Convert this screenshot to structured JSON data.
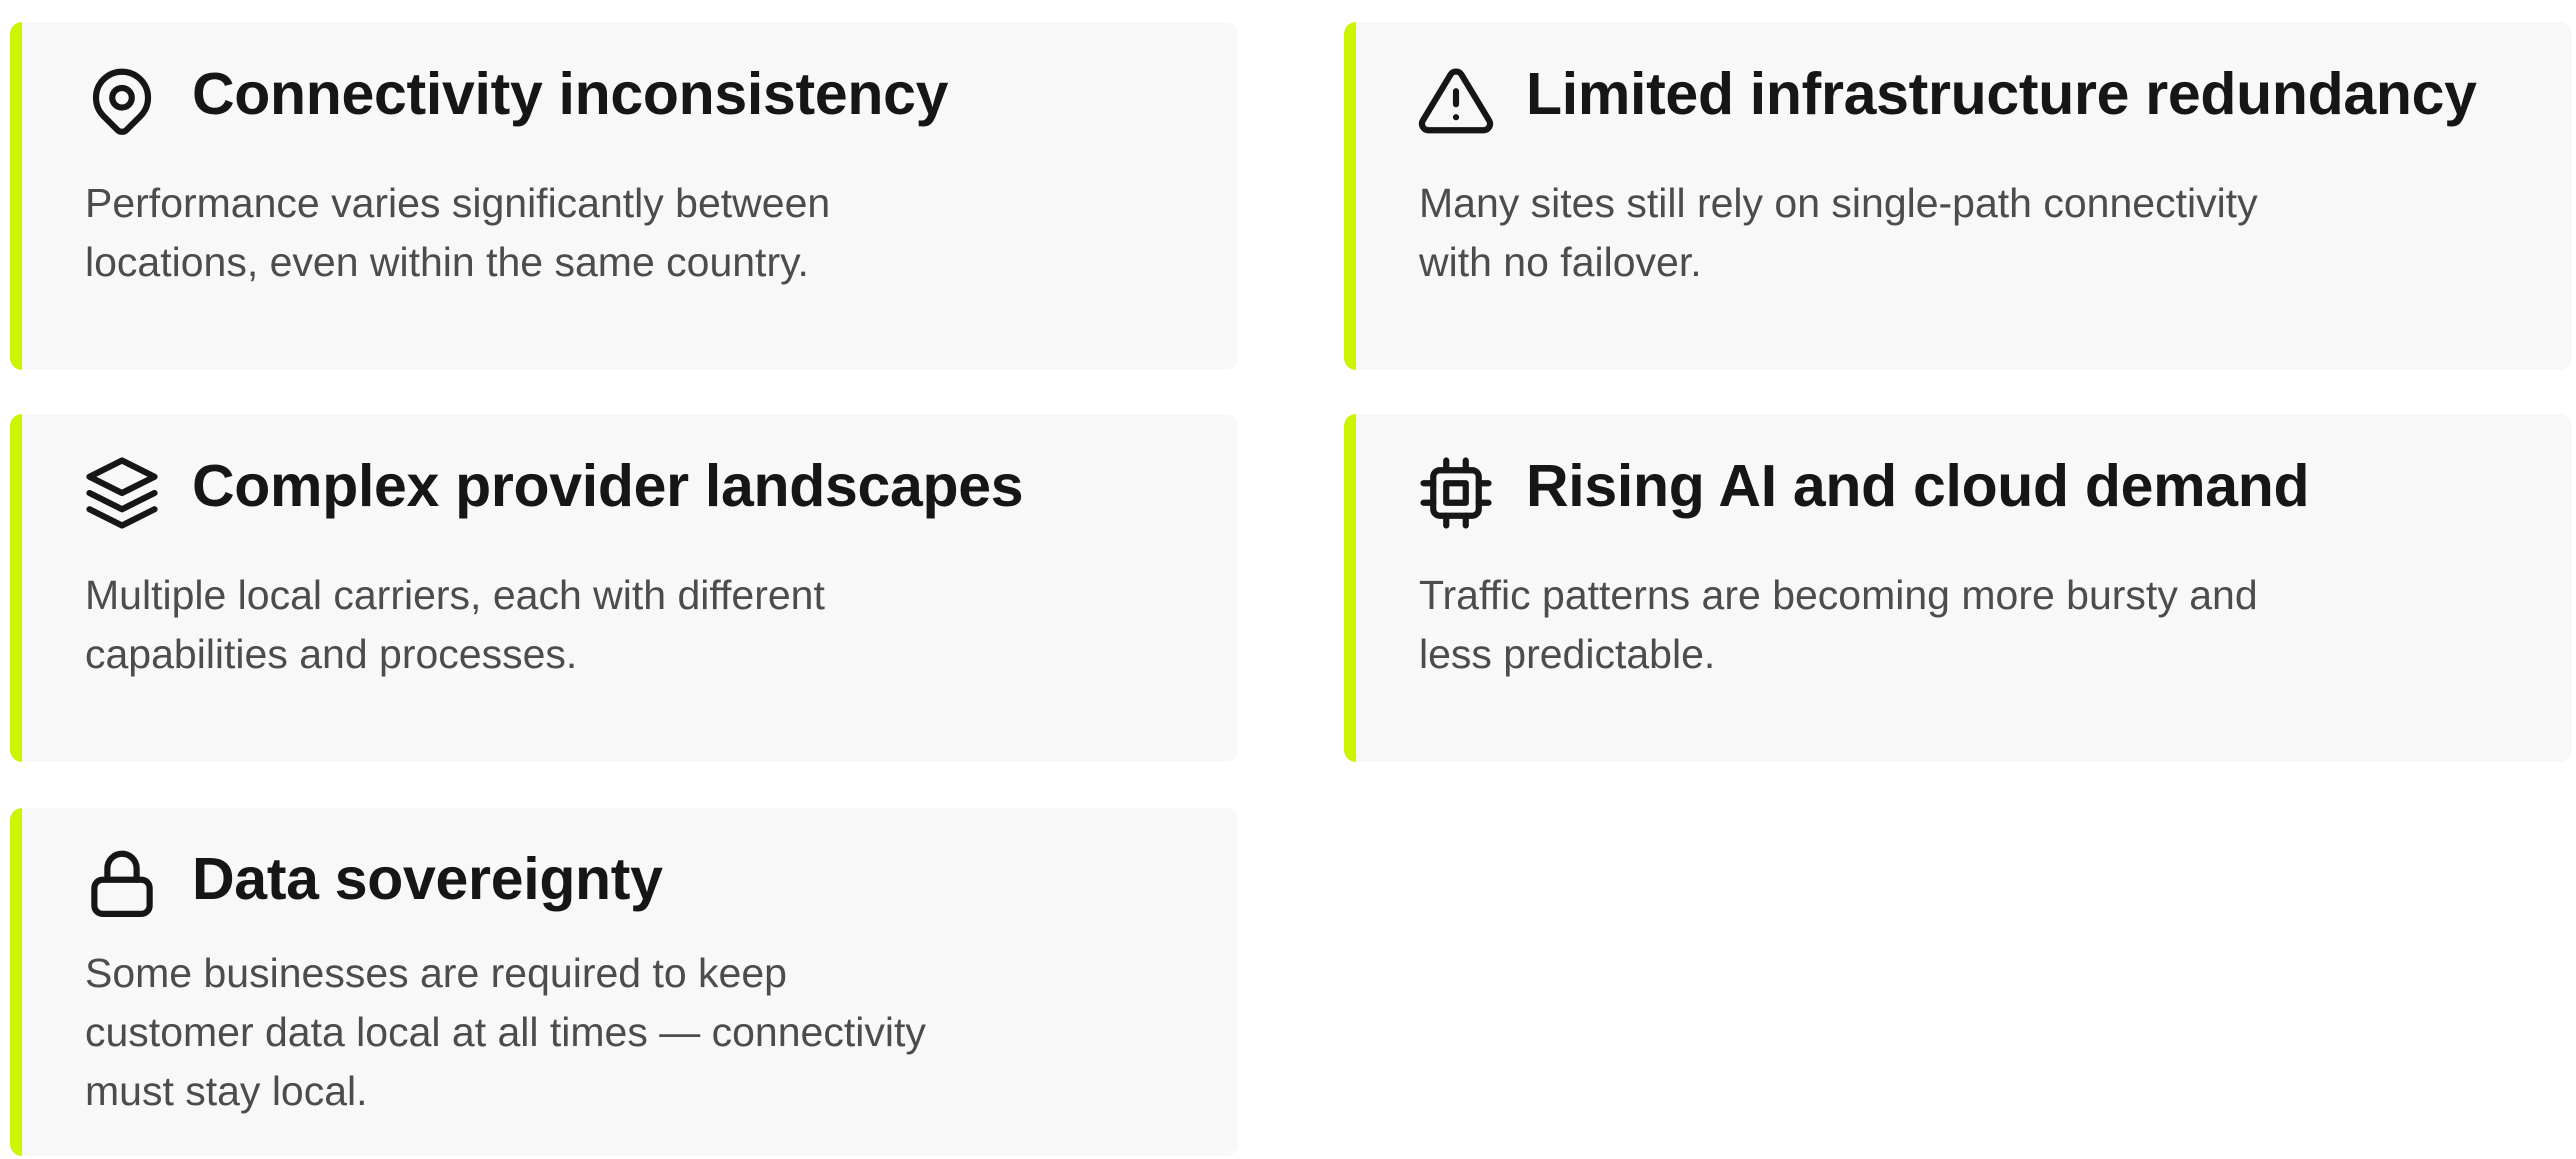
{
  "theme": {
    "accent": "#cdf500",
    "card_background": "#f8f8f8",
    "title_color": "#161616",
    "description_color": "#4c4c4c"
  },
  "cards": [
    {
      "icon": "map-pin-icon",
      "title": "Connectivity inconsistency",
      "description_lines": [
        "Performance varies significantly between",
        "locations, even within the same country."
      ]
    },
    {
      "icon": "warning-triangle-icon",
      "title": "Limited infrastructure redundancy",
      "description_lines": [
        "Many sites still rely on single-path connectivity",
        "with no failover."
      ]
    },
    {
      "icon": "layers-icon",
      "title": "Complex provider landscapes",
      "description_lines": [
        "Multiple local carriers, each with different",
        "capabilities and processes."
      ]
    },
    {
      "icon": "cpu-chip-icon",
      "title": "Rising AI and cloud demand",
      "description_lines": [
        "Traffic patterns are becoming more bursty and",
        "less predictable."
      ]
    },
    {
      "icon": "lock-icon",
      "title": "Data sovereignty",
      "description_lines": [
        "Some businesses are required to keep",
        "customer data local at all times — connectivity",
        "must stay local."
      ]
    }
  ]
}
